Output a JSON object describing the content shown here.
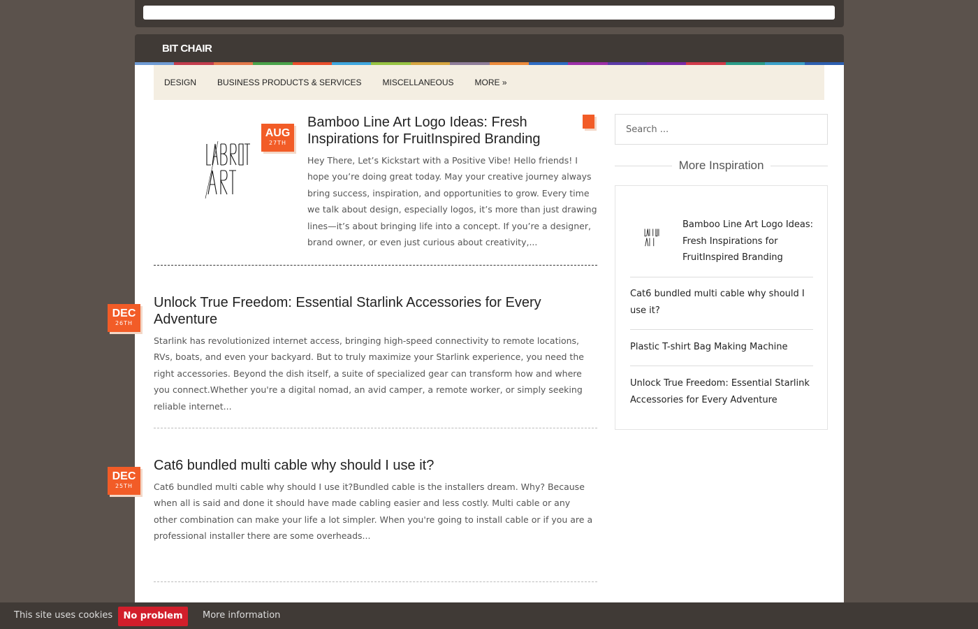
{
  "site": {
    "title": "BIT CHAIR"
  },
  "header": {
    "stripe_colors": [
      "#6f9bd4",
      "#c33c4c",
      "#e3784a",
      "#4aa34a",
      "#e84e2c",
      "#3fa6de",
      "#97c342",
      "#d6a540",
      "#8f7d9a",
      "#ec8a3a",
      "#2e6cc4",
      "#9c2fa8",
      "#5b3aa7",
      "#7a2aa8",
      "#d13a4a",
      "#2a9c88",
      "#3aa0c8",
      "#2d5fb0"
    ]
  },
  "nav": {
    "items": [
      {
        "label": "DESIGN"
      },
      {
        "label": "BUSINESS PRODUCTS & SERVICES"
      },
      {
        "label": "MISCELLANEOUS"
      },
      {
        "label": "MORE »"
      }
    ]
  },
  "posts": [
    {
      "month": "AUG",
      "day": "27TH",
      "title": "Bamboo Line Art Logo Ideas: Fresh Inspirations for FruitInspired Branding",
      "excerpt": "Hey There, Let’s Kickstart with a Positive Vibe! Hello friends! I hope you’re doing great today. May your creative journey always bring success, inspiration, and opportunities to grow. Every time we talk about design, especially logos, it’s more than just drawing lines—it’s about bringing life into a concept. If you’re a designer, brand owner, or even just curious about creativity,..."
    },
    {
      "month": "DEC",
      "day": "26TH",
      "title": "Unlock True Freedom: Essential Starlink Accessories for Every Adventure",
      "excerpt": "Starlink has revolutionized internet access, bringing high-speed connectivity to remote locations, RVs, boats, and even your backyard. But to truly maximize your Starlink experience, you need the right accessories. Beyond the dish itself, a suite of specialized gear can transform how and where you connect.Whether you're a digital nomad, an avid camper, a remote worker, or simply seeking reliable internet..."
    },
    {
      "month": "DEC",
      "day": "25TH",
      "title": "Cat6 bundled multi cable why should I use it?",
      "excerpt": "Cat6 bundled multi cable why should I use it?Bundled cable is the installers dream. Why? Because when all is said and done it should have made cabling easier and less costly. Multi cable or any other combination can make your life a lot simpler. When you're going to install cable or if you are a professional installer there are some overheads..."
    }
  ],
  "sidebar": {
    "search_placeholder": "Search ...",
    "widget_title": "More Inspiration",
    "items": [
      {
        "label": "Bamboo Line Art Logo Ideas: Fresh Inspirations for FruitInspired Branding"
      },
      {
        "label": "Cat6 bundled multi cable why should I use it?"
      },
      {
        "label": "Plastic T-shirt Bag Making Machine"
      },
      {
        "label": "Unlock True Freedom: Essential Starlink Accessories for Every Adventure"
      }
    ]
  },
  "cookie": {
    "text": "This site uses cookies",
    "button_label": "No problem",
    "more_label": "More information"
  },
  "colors": {
    "accent": "#f25c27",
    "cookie_button": "#d21e2b",
    "header_bg": "#403a36",
    "page_bg": "#5b524c",
    "nav_bg": "#f4eee2"
  },
  "logo_text": [
    "LABROT",
    "ART"
  ]
}
